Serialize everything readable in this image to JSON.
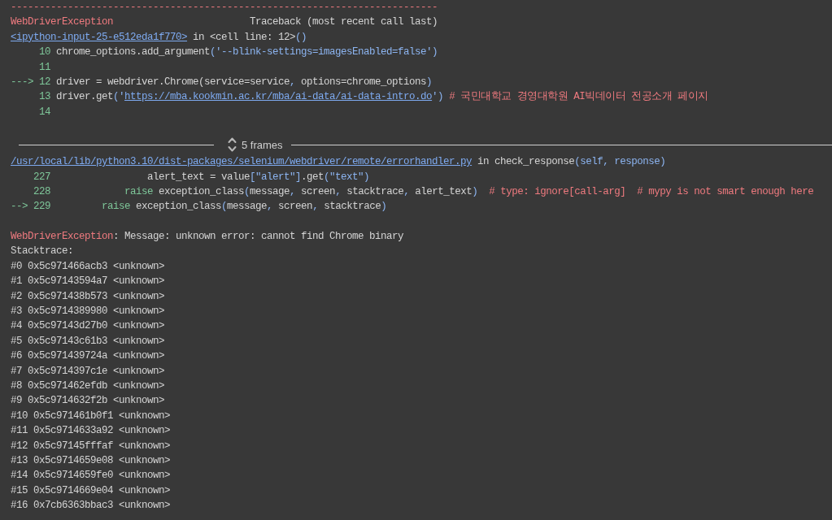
{
  "traceback": {
    "rule": "---------------------------------------------------------------------------",
    "exception": "WebDriverException",
    "heading": "Traceback (most recent call last)",
    "blocks": [
      {
        "kind": "frame",
        "location": [
          {
            "kind": "link",
            "text": "<ipython-input-25-e512eda1f770>"
          },
          {
            "kind": "plain",
            "text": " in <cell line: 12>"
          },
          {
            "kind": "accent",
            "text": "()"
          }
        ],
        "lines": [
          {
            "number": "10",
            "code": [
              {
                "kind": "plain",
                "text": "chrome_options.add_argument"
              },
              {
                "kind": "accent",
                "text": "('--blink-settings=imagesEnabled=false')"
              }
            ]
          },
          {
            "number": "11"
          },
          {
            "marker": "--->",
            "number": "12",
            "code": [
              {
                "kind": "plain",
                "text": "driver = webdriver.Chrome(service=service"
              },
              {
                "kind": "accent",
                "text": ","
              },
              {
                "kind": "plain",
                "text": " options=chrome_options"
              },
              {
                "kind": "accent",
                "text": ")"
              }
            ]
          },
          {
            "number": "13",
            "code": [
              {
                "kind": "plain",
                "text": "driver.get"
              },
              {
                "kind": "accent",
                "text": "('"
              },
              {
                "kind": "link",
                "text": "https://mba.kookmin.ac.kr/mba/ai-data/ai-data-intro.do"
              },
              {
                "kind": "accent",
                "text": "')"
              },
              {
                "kind": "comment",
                "text": " # 국민대학교 경영대학원 AI빅데이터 전공소개 페이지"
              }
            ]
          },
          {
            "number": "14"
          }
        ]
      },
      {
        "kind": "collapsed",
        "label": "5 frames"
      },
      {
        "kind": "frame",
        "location": [
          {
            "kind": "link",
            "text": "/usr/local/lib/python3.10/dist-packages/selenium/webdriver/remote/errorhandler.py"
          },
          {
            "kind": "plain",
            "text": " in check_response"
          },
          {
            "kind": "accent",
            "text": "(self, response)"
          }
        ],
        "lines": [
          {
            "number": "227",
            "code": [
              {
                "kind": "plain",
                "text": "                alert_text = value"
              },
              {
                "kind": "accent",
                "text": "[\"alert\"]"
              },
              {
                "kind": "plain",
                "text": ".get"
              },
              {
                "kind": "accent",
                "text": "(\"text\")"
              }
            ]
          },
          {
            "number": "228",
            "code": [
              {
                "kind": "keyword",
                "text": "            raise"
              },
              {
                "kind": "plain",
                "text": " exception_class"
              },
              {
                "kind": "accent",
                "text": "("
              },
              {
                "kind": "plain",
                "text": "message"
              },
              {
                "kind": "accent",
                "text": ","
              },
              {
                "kind": "plain",
                "text": " screen"
              },
              {
                "kind": "accent",
                "text": ","
              },
              {
                "kind": "plain",
                "text": " stacktrace"
              },
              {
                "kind": "accent",
                "text": ","
              },
              {
                "kind": "plain",
                "text": " alert_text"
              },
              {
                "kind": "accent",
                "text": ")"
              },
              {
                "kind": "comment",
                "text": "  # type: ignore[call-arg]  # mypy is not smart enough here"
              }
            ]
          },
          {
            "marker": "-->",
            "number": "229",
            "code": [
              {
                "kind": "keyword",
                "text": "        raise"
              },
              {
                "kind": "plain",
                "text": " exception_class"
              },
              {
                "kind": "accent",
                "text": "("
              },
              {
                "kind": "plain",
                "text": "message"
              },
              {
                "kind": "accent",
                "text": ","
              },
              {
                "kind": "plain",
                "text": " screen"
              },
              {
                "kind": "accent",
                "text": ","
              },
              {
                "kind": "plain",
                "text": " stacktrace"
              },
              {
                "kind": "accent",
                "text": ")"
              }
            ]
          }
        ]
      }
    ],
    "error": {
      "message": [
        {
          "kind": "error",
          "text": "WebDriverException"
        },
        {
          "kind": "plain",
          "text": ": Message: unknown error: cannot find Chrome binary"
        }
      ],
      "stacktrace_label": "Stacktrace:",
      "stacktrace": [
        "#0 0x5c971466acb3 <unknown>",
        "#1 0x5c97143594a7 <unknown>",
        "#2 0x5c971438b573 <unknown>",
        "#3 0x5c9714389980 <unknown>",
        "#4 0x5c97143d27b0 <unknown>",
        "#5 0x5c97143c61b3 <unknown>",
        "#6 0x5c971439724a <unknown>",
        "#7 0x5c9714397c1e <unknown>",
        "#8 0x5c971462efdb <unknown>",
        "#9 0x5c9714632f2b <unknown>",
        "#10 0x5c971461b0f1 <unknown>",
        "#11 0x5c9714633a92 <unknown>",
        "#12 0x5c97145fffaf <unknown>",
        "#13 0x5c9714659e08 <unknown>",
        "#14 0x5c9714659fe0 <unknown>",
        "#15 0x5c9714669e04 <unknown>",
        "#16 0x7cb6363bbac3 <unknown>"
      ]
    }
  }
}
